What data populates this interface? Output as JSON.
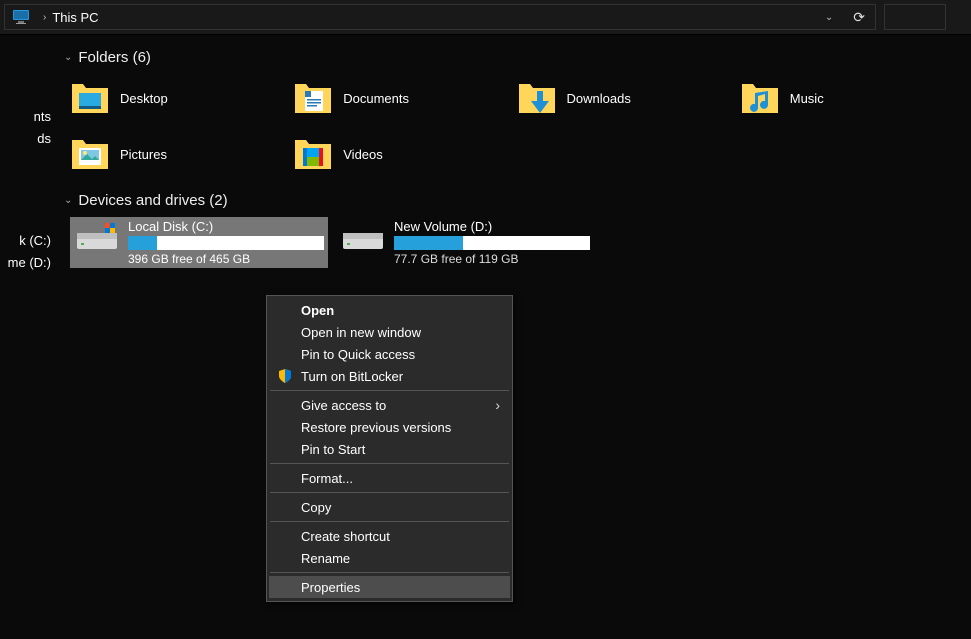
{
  "addressbar": {
    "location": "This PC"
  },
  "sidebar": {
    "items": [
      "nts",
      "ds",
      "",
      "",
      "",
      "",
      "k (C:)",
      "me (D:)"
    ]
  },
  "sections": {
    "folders": {
      "title": "Folders (6)",
      "items": [
        {
          "label": "Desktop",
          "icon": "desktop"
        },
        {
          "label": "Documents",
          "icon": "documents"
        },
        {
          "label": "Downloads",
          "icon": "downloads"
        },
        {
          "label": "Music",
          "icon": "music"
        },
        {
          "label": "Pictures",
          "icon": "pictures"
        },
        {
          "label": "Videos",
          "icon": "videos"
        }
      ]
    },
    "drives": {
      "title": "Devices and drives (2)",
      "items": [
        {
          "name": "Local Disk (C:)",
          "free_text": "396 GB free of 465 GB",
          "fill_percent": 15,
          "selected": true
        },
        {
          "name": "New Volume (D:)",
          "free_text": "77.7 GB free of 119 GB",
          "fill_percent": 35,
          "selected": false
        }
      ]
    }
  },
  "context_menu": {
    "items": [
      {
        "label": "Open",
        "bold": true
      },
      {
        "label": "Open in new window"
      },
      {
        "label": "Pin to Quick access"
      },
      {
        "label": "Turn on BitLocker",
        "shield": true
      },
      {
        "sep": true
      },
      {
        "label": "Give access to",
        "submenu": true
      },
      {
        "label": "Restore previous versions"
      },
      {
        "label": "Pin to Start"
      },
      {
        "sep": true
      },
      {
        "label": "Format..."
      },
      {
        "sep": true
      },
      {
        "label": "Copy"
      },
      {
        "sep": true
      },
      {
        "label": "Create shortcut"
      },
      {
        "label": "Rename"
      },
      {
        "sep": true
      },
      {
        "label": "Properties",
        "hover": true
      }
    ]
  }
}
